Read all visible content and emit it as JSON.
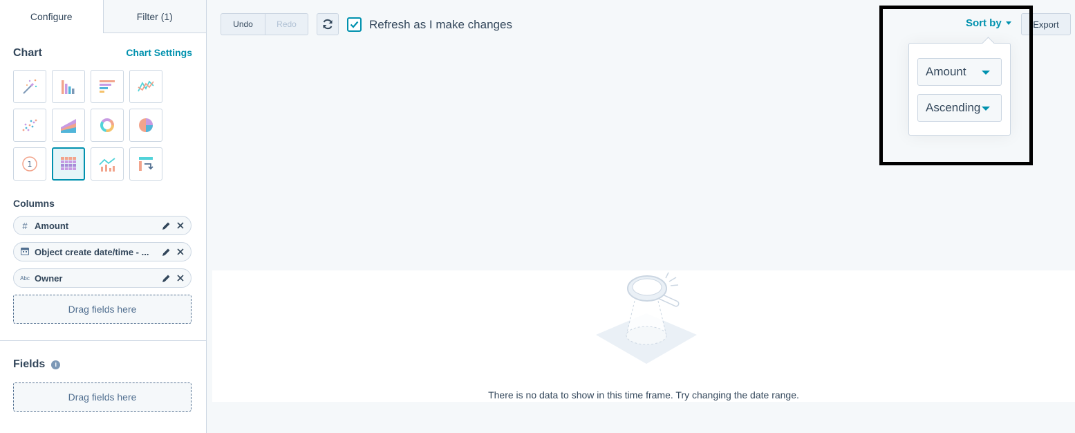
{
  "left_panel": {
    "tabs": {
      "configure": "Configure",
      "filter": "Filter (1)"
    },
    "chart": {
      "title": "Chart",
      "settings_link": "Chart Settings",
      "types": [
        "magic-wand",
        "vertical-bar",
        "horizontal-bar",
        "line",
        "scatter",
        "area",
        "donut",
        "pie",
        "kpi",
        "table",
        "combo",
        "pivot"
      ],
      "selected_type": "table",
      "kpi_number": "1"
    },
    "columns": {
      "title": "Columns",
      "items": [
        {
          "type_glyph": "#",
          "label": "Amount"
        },
        {
          "type_glyph": "calendar",
          "label": "Object create date/time - ..."
        },
        {
          "type_glyph": "Abc",
          "label": "Owner"
        }
      ],
      "drop_label": "Drag fields here"
    },
    "fields": {
      "title": "Fields",
      "info_glyph": "i",
      "drop_label": "Drag fields here"
    }
  },
  "toolbar": {
    "undo": "Undo",
    "redo": "Redo",
    "refresh_label": "Refresh as I make changes",
    "refresh_checked": true,
    "sort_by": "Sort by",
    "export": "Export"
  },
  "sort_popover": {
    "field": "Amount",
    "direction": "Ascending"
  },
  "empty_state": {
    "message": "There is no data to show in this time frame. Try changing the date range."
  },
  "colors": {
    "accent": "#0091ae",
    "text": "#33475b",
    "border": "#cbd6e2",
    "background": "#f5f8fa"
  }
}
